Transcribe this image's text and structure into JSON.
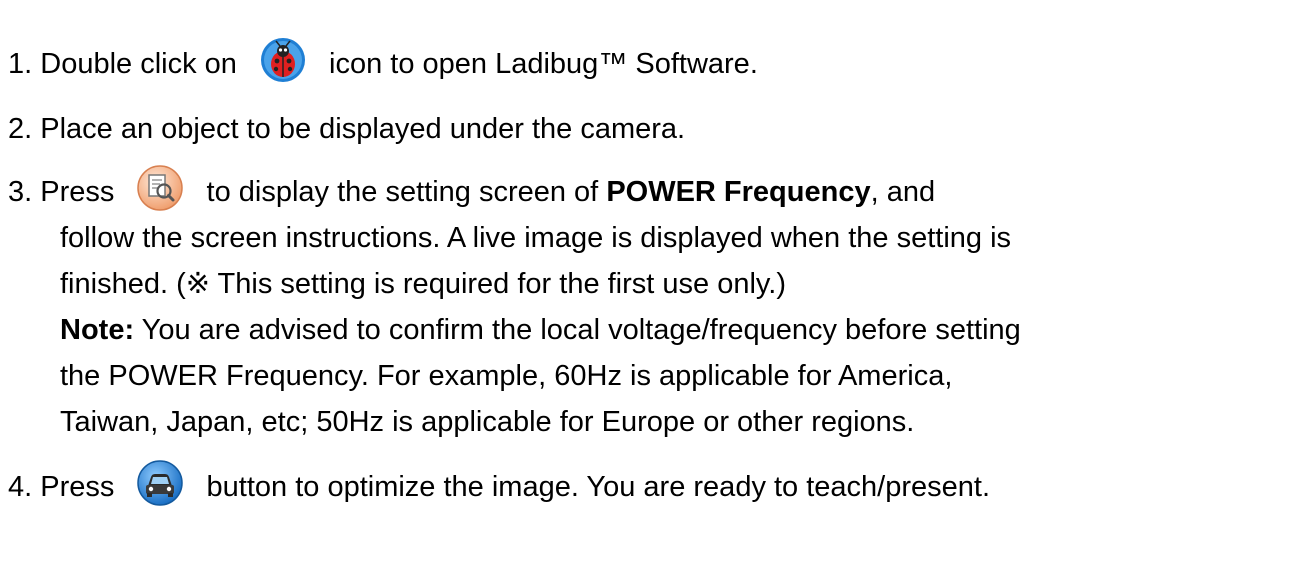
{
  "steps": [
    {
      "number": "1.",
      "pre": "Double click on",
      "icon": "ladybug-icon",
      "post": "icon to open Ladibug™ Software."
    },
    {
      "number": "2.",
      "text": "Place an object to be displayed under the camera."
    },
    {
      "number": "3.",
      "pre": "Press",
      "icon": "settings-magnifier-icon",
      "post_a": "to display the setting screen of",
      "post_bold": "POWER Frequency",
      "post_b": ", and",
      "line2": "follow the screen instructions. A live image is displayed when the setting is",
      "line3": "finished. (※ This setting is required for the first use only.)",
      "note_label": "Note:",
      "note_line1": " You are advised to confirm the local voltage/frequency before setting",
      "note_line2": "the POWER Frequency. For example, 60Hz is applicable for America,",
      "note_line3": "Taiwan, Japan, etc; 50Hz is applicable for Europe or other regions."
    },
    {
      "number": "4.",
      "pre": "Press",
      "icon": "auto-tune-car-icon",
      "post": "button to optimize the image. You are ready to teach/present."
    }
  ],
  "colors": {
    "text": "#000000",
    "icon_blue": "#1f7fd4",
    "icon_orange": "#f0a070",
    "ladybug_red": "#e02020"
  }
}
